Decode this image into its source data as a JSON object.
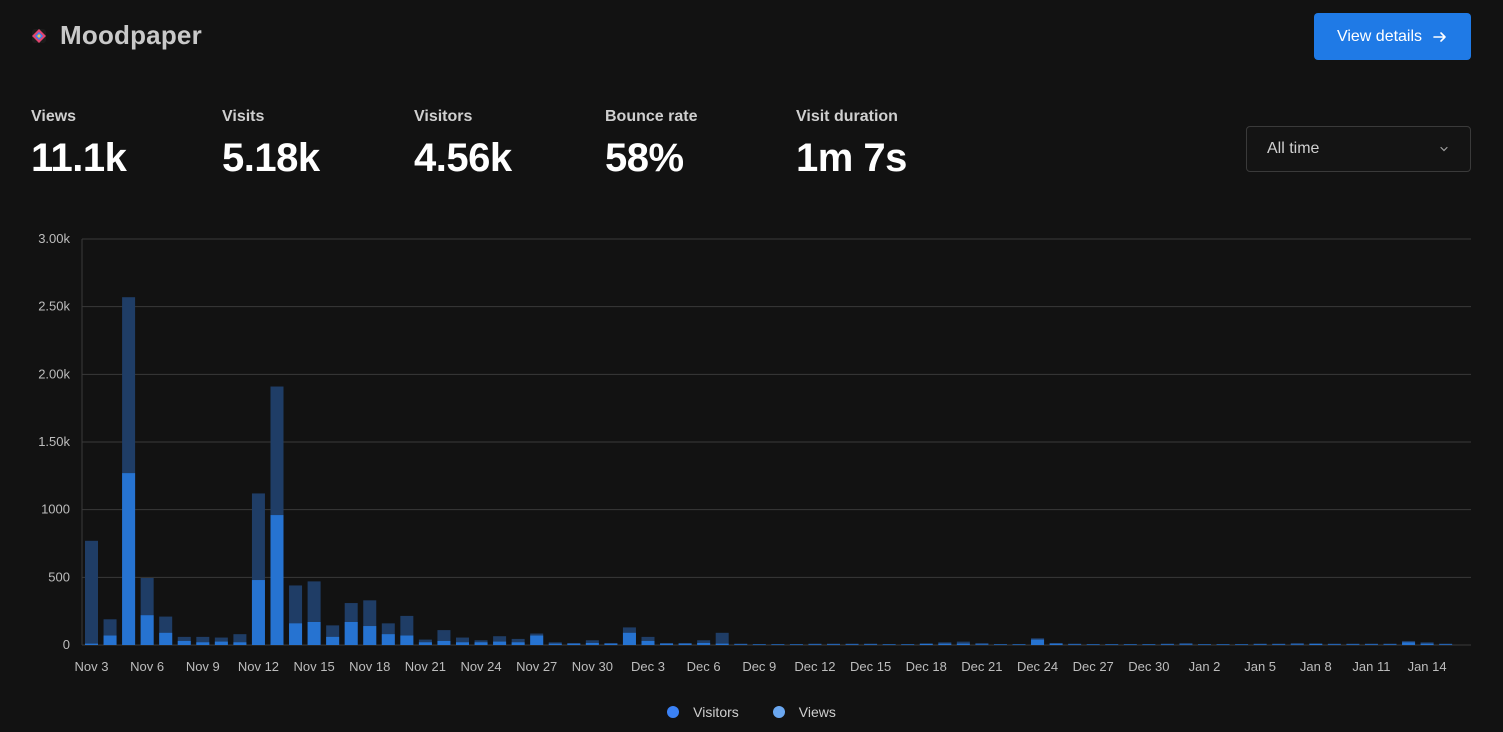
{
  "header": {
    "site_name": "Moodpaper",
    "details_button": "View details",
    "logo_icon": "moodpaper-logo-icon"
  },
  "metrics": [
    {
      "label": "Views",
      "value": "11.1k"
    },
    {
      "label": "Visits",
      "value": "5.18k"
    },
    {
      "label": "Visitors",
      "value": "4.56k"
    },
    {
      "label": "Bounce rate",
      "value": "58%"
    },
    {
      "label": "Visit duration",
      "value": "1m 7s"
    }
  ],
  "period_select": {
    "value": "All time"
  },
  "colors": {
    "background": "#121212",
    "accent": "#1f7ae6",
    "visitors_bar": "#2673d1",
    "views_bar": "#1f3d66",
    "visitors_legend": "#3b82f6",
    "views_legend": "#6aa7f0"
  },
  "chart_data": {
    "type": "bar",
    "stacked_overlay": true,
    "ylim": [
      0,
      3000
    ],
    "y_ticks": [
      "0",
      "500",
      "1000",
      "1.50k",
      "2.00k",
      "2.50k",
      "3.00k"
    ],
    "y_tick_values": [
      0,
      500,
      1000,
      1500,
      2000,
      2500,
      3000
    ],
    "x_ticks": [
      "Nov 3",
      "Nov 6",
      "Nov 9",
      "Nov 12",
      "Nov 15",
      "Nov 18",
      "Nov 21",
      "Nov 24",
      "Nov 27",
      "Nov 30",
      "Dec 3",
      "Dec 6",
      "Dec 9",
      "Dec 12",
      "Dec 15",
      "Dec 18",
      "Dec 21",
      "Dec 24",
      "Dec 27",
      "Dec 30",
      "Jan 2",
      "Jan 5",
      "Jan 8",
      "Jan 11",
      "Jan 14"
    ],
    "categories": [
      "Nov 3",
      "Nov 4",
      "Nov 5",
      "Nov 6",
      "Nov 7",
      "Nov 8",
      "Nov 9",
      "Nov 10",
      "Nov 11",
      "Nov 12",
      "Nov 13",
      "Nov 14",
      "Nov 15",
      "Nov 16",
      "Nov 17",
      "Nov 18",
      "Nov 19",
      "Nov 20",
      "Nov 21",
      "Nov 22",
      "Nov 23",
      "Nov 24",
      "Nov 25",
      "Nov 26",
      "Nov 27",
      "Nov 28",
      "Nov 29",
      "Nov 30",
      "Dec 1",
      "Dec 2",
      "Dec 3",
      "Dec 4",
      "Dec 5",
      "Dec 6",
      "Dec 7",
      "Dec 8",
      "Dec 9",
      "Dec 10",
      "Dec 11",
      "Dec 12",
      "Dec 13",
      "Dec 14",
      "Dec 15",
      "Dec 16",
      "Dec 17",
      "Dec 18",
      "Dec 19",
      "Dec 20",
      "Dec 21",
      "Dec 22",
      "Dec 23",
      "Dec 24",
      "Dec 25",
      "Dec 26",
      "Dec 27",
      "Dec 28",
      "Dec 29",
      "Dec 30",
      "Dec 31",
      "Jan 1",
      "Jan 2",
      "Jan 3",
      "Jan 4",
      "Jan 5",
      "Jan 6",
      "Jan 7",
      "Jan 8",
      "Jan 9",
      "Jan 10",
      "Jan 11",
      "Jan 12",
      "Jan 13",
      "Jan 14",
      "Jan 15"
    ],
    "series": [
      {
        "name": "Visitors",
        "values": [
          10,
          70,
          1270,
          220,
          90,
          30,
          20,
          25,
          20,
          480,
          960,
          160,
          170,
          60,
          170,
          140,
          80,
          70,
          20,
          30,
          20,
          20,
          25,
          20,
          70,
          10,
          10,
          15,
          10,
          90,
          30,
          10,
          10,
          15,
          10,
          5,
          5,
          5,
          5,
          5,
          5,
          5,
          5,
          5,
          5,
          10,
          10,
          10,
          5,
          5,
          5,
          40,
          10,
          5,
          5,
          5,
          5,
          5,
          5,
          5,
          5,
          5,
          5,
          5,
          5,
          5,
          10,
          5,
          5,
          5,
          5,
          20,
          10,
          5
        ]
      },
      {
        "name": "Views",
        "values": [
          770,
          190,
          2570,
          495,
          210,
          60,
          60,
          55,
          80,
          1120,
          1910,
          440,
          470,
          145,
          310,
          330,
          160,
          215,
          40,
          110,
          55,
          35,
          65,
          45,
          85,
          20,
          15,
          35,
          15,
          130,
          60,
          15,
          15,
          35,
          90,
          10,
          5,
          5,
          5,
          10,
          10,
          10,
          10,
          5,
          5,
          5,
          20,
          25,
          15,
          5,
          5,
          50,
          15,
          10,
          5,
          5,
          5,
          5,
          10,
          15,
          5,
          5,
          5,
          10,
          10,
          15,
          5,
          10,
          10,
          10,
          10,
          30,
          20,
          10
        ]
      }
    ],
    "legend": [
      "Visitors",
      "Views"
    ],
    "legend_position": "bottom-center",
    "grid": true
  }
}
